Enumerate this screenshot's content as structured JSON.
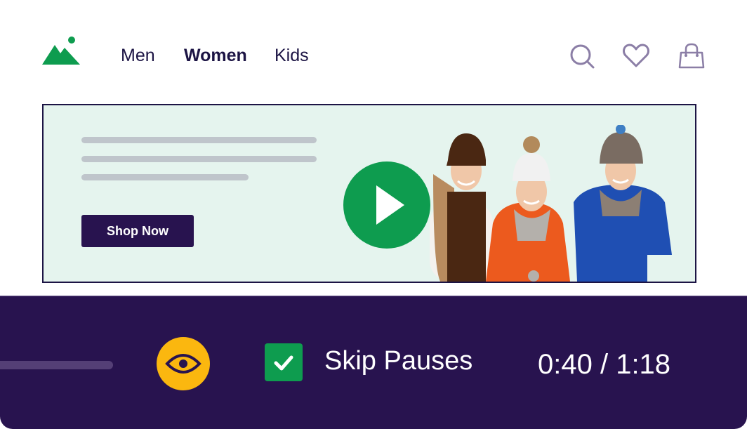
{
  "header": {
    "logo": "mountain-logo",
    "nav": [
      {
        "label": "Men",
        "active": false
      },
      {
        "label": "Women",
        "active": true
      },
      {
        "label": "Kids",
        "active": false
      }
    ],
    "icons": [
      "search-icon",
      "heart-icon",
      "shopping-bag-icon"
    ]
  },
  "banner": {
    "cta_label": "Shop Now",
    "image_description": "Three women in knit hats pulled over their eyes, wearing scarves and sweaters",
    "play_icon": "play-icon"
  },
  "player": {
    "skip_label": "Skip Pauses",
    "skip_checked": true,
    "current_time": "0:40",
    "total_time": "1:18",
    "time_display": "0:40 / 1:18",
    "eye_icon": "eye-icon"
  },
  "colors": {
    "brand_green": "#0e9c4f",
    "dark_purple": "#28134f",
    "navy_text": "#1c1444",
    "banner_bg": "#e5f4ee",
    "eye_yellow": "#fbb70f",
    "icon_gray": "#8b7ea6"
  }
}
